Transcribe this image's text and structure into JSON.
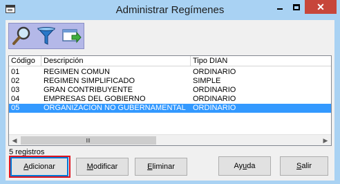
{
  "window": {
    "title": "Administrar Regímenes"
  },
  "toolbar": {
    "icons": [
      "magnifier-icon",
      "filter-icon",
      "export-window-icon"
    ]
  },
  "list": {
    "columns": [
      "Código",
      "Descripción",
      "Tipo DIAN"
    ],
    "rows": [
      {
        "codigo": "01",
        "descripcion": "REGIMEN COMUN",
        "tipo": "ORDINARIO"
      },
      {
        "codigo": "02",
        "descripcion": "REGIMEN SIMPLIFICADO",
        "tipo": "SIMPLE"
      },
      {
        "codigo": "03",
        "descripcion": "GRAN CONTRIBUYENTE",
        "tipo": "ORDINARIO"
      },
      {
        "codigo": "04",
        "descripcion": "EMPRESAS DEL GOBIERNO",
        "tipo": "ORDINARIO"
      },
      {
        "codigo": "05",
        "descripcion": "ORGANIZACION NO GUBERNAMENTAL",
        "tipo": "ORDINARIO"
      }
    ],
    "selected_index": 4
  },
  "status": {
    "count": "5 registros"
  },
  "buttons": {
    "add_u": "A",
    "add_rest": "dicionar",
    "mod_u": "M",
    "mod_rest": "odificar",
    "del_u": "E",
    "del_rest": "liminar",
    "help_pre": "Ay",
    "help_u": "u",
    "help_rest": "da",
    "exit_u": "S",
    "exit_rest": "alir"
  },
  "colors": {
    "titlebar": "#a9d2f3",
    "selection": "#3399ff",
    "close": "#c7463a",
    "highlight": "#e0141e"
  }
}
